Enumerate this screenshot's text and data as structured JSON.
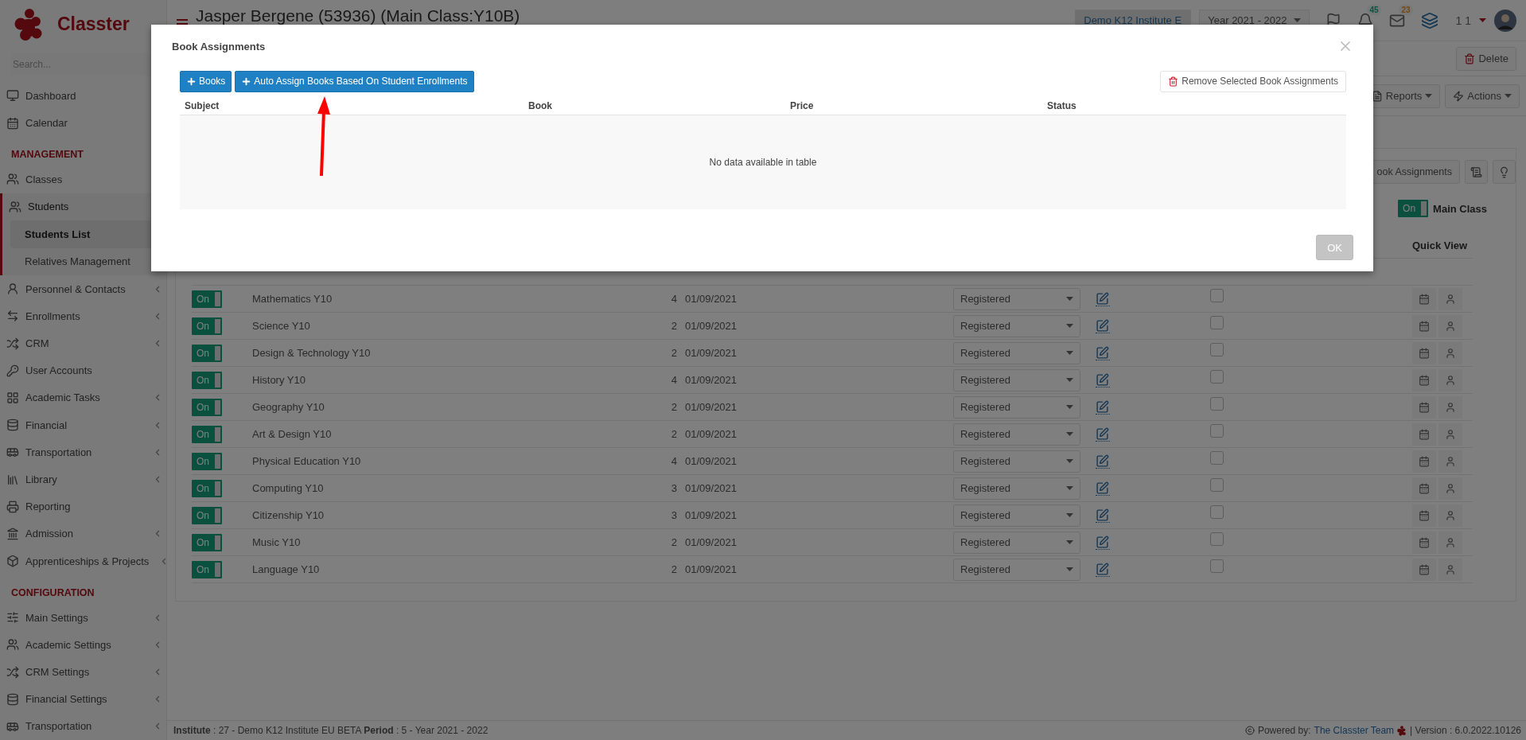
{
  "app": {
    "logo_text": "Classter"
  },
  "sidebar": {
    "search_placeholder": "Search...",
    "items": [
      {
        "kind": "link",
        "label": "Dashboard",
        "selected": false
      },
      {
        "kind": "link",
        "label": "Calendar",
        "selected": false
      },
      {
        "kind": "heading",
        "label": "MANAGEMENT"
      },
      {
        "kind": "link",
        "label": "Classes",
        "selected": false
      },
      {
        "kind": "link",
        "label": "Students",
        "selected": false,
        "expanded": true,
        "children": [
          {
            "label": "Students List",
            "selected": true
          },
          {
            "label": "Relatives Management",
            "selected": false
          }
        ]
      },
      {
        "kind": "link",
        "label": "Personnel & Contacts",
        "selected": false,
        "expanded": false
      },
      {
        "kind": "link",
        "label": "Enrollments",
        "selected": false,
        "expanded": false
      },
      {
        "kind": "link",
        "label": "CRM",
        "selected": false,
        "expanded": false
      },
      {
        "kind": "link",
        "label": "User Accounts",
        "selected": false
      },
      {
        "kind": "link",
        "label": "Academic Tasks",
        "selected": false,
        "expanded": false
      },
      {
        "kind": "link",
        "label": "Financial",
        "selected": false,
        "expanded": false
      },
      {
        "kind": "link",
        "label": "Transportation",
        "selected": false,
        "expanded": false
      },
      {
        "kind": "link",
        "label": "Library",
        "selected": false,
        "expanded": false
      },
      {
        "kind": "link",
        "label": "Reporting",
        "selected": false
      },
      {
        "kind": "link",
        "label": "Admission",
        "selected": false,
        "expanded": false
      },
      {
        "kind": "link",
        "label": "Apprenticeships & Projects",
        "selected": false,
        "expanded": false
      },
      {
        "kind": "heading",
        "label": "CONFIGURATION"
      },
      {
        "kind": "link",
        "label": "Main Settings",
        "selected": false,
        "expanded": false
      },
      {
        "kind": "link",
        "label": "Academic Settings",
        "selected": false,
        "expanded": false
      },
      {
        "kind": "link",
        "label": "CRM Settings",
        "selected": false,
        "expanded": false
      },
      {
        "kind": "link",
        "label": "Financial Settings",
        "selected": false,
        "expanded": false
      },
      {
        "kind": "link",
        "label": "Transportation",
        "selected": false,
        "expanded": false
      }
    ]
  },
  "header": {
    "title": "Jasper Bergene (53936) (Main Class:Y10B)",
    "institute": "Demo K12 Institute E",
    "year": "Year 2021 - 2022",
    "notifications": [
      {
        "count": "45"
      },
      {
        "count": "23"
      }
    ],
    "user": "1 1"
  },
  "toolbar": {
    "delete": "Delete",
    "reports": "Reports",
    "actions": "Actions",
    "book_assignments": "ook Assignments"
  },
  "main_class_toggle": {
    "label": "On",
    "on": true,
    "caption": "Main Class"
  },
  "table": {
    "quick_view_heading": "Quick View",
    "rows": [
      {
        "label": "On",
        "on": true,
        "subject": "Mathematics Y10",
        "count": "4",
        "date": "01/09/2021",
        "status": "Registered",
        "checked": false
      },
      {
        "label": "On",
        "on": true,
        "subject": "Science Y10",
        "count": "2",
        "date": "01/09/2021",
        "status": "Registered",
        "checked": false
      },
      {
        "label": "On",
        "on": true,
        "subject": "Design & Technology Y10",
        "count": "2",
        "date": "01/09/2021",
        "status": "Registered",
        "checked": false
      },
      {
        "label": "On",
        "on": true,
        "subject": "History Y10",
        "count": "4",
        "date": "01/09/2021",
        "status": "Registered",
        "checked": false
      },
      {
        "label": "On",
        "on": true,
        "subject": "Geography Y10",
        "count": "2",
        "date": "01/09/2021",
        "status": "Registered",
        "checked": false
      },
      {
        "label": "On",
        "on": true,
        "subject": "Art & Design Y10",
        "count": "2",
        "date": "01/09/2021",
        "status": "Registered",
        "checked": false
      },
      {
        "label": "On",
        "on": true,
        "subject": "Physical Education Y10",
        "count": "4",
        "date": "01/09/2021",
        "status": "Registered",
        "checked": false
      },
      {
        "label": "On",
        "on": true,
        "subject": "Computing Y10",
        "count": "3",
        "date": "01/09/2021",
        "status": "Registered",
        "checked": false
      },
      {
        "label": "On",
        "on": true,
        "subject": "Citizenship Y10",
        "count": "3",
        "date": "01/09/2021",
        "status": "Registered",
        "checked": false
      },
      {
        "label": "On",
        "on": true,
        "subject": "Music Y10",
        "count": "2",
        "date": "01/09/2021",
        "status": "Registered",
        "checked": false
      },
      {
        "label": "On",
        "on": true,
        "subject": "Language Y10",
        "count": "2",
        "date": "01/09/2021",
        "status": "Registered",
        "checked": false
      }
    ]
  },
  "footer": {
    "info": "**Institute** : 27 - Demo K12 Institute EU BETA **Period** : 5 - Year 2021 - 2022",
    "powered_by": "Powered by:",
    "team_link": "The Classter Team",
    "version": "| Version : 6.0.2022.10126"
  },
  "modal": {
    "title": "Book Assignments",
    "buttons": [
      "Books",
      "Auto Assign Books Based On Student Enrollments"
    ],
    "remove": "Remove Selected Book Assignments",
    "columns": [
      "Subject",
      "Book",
      "Price",
      "Status"
    ],
    "empty": "No data available in table",
    "ok": {
      "label": "OK",
      "disabled": true
    }
  }
}
